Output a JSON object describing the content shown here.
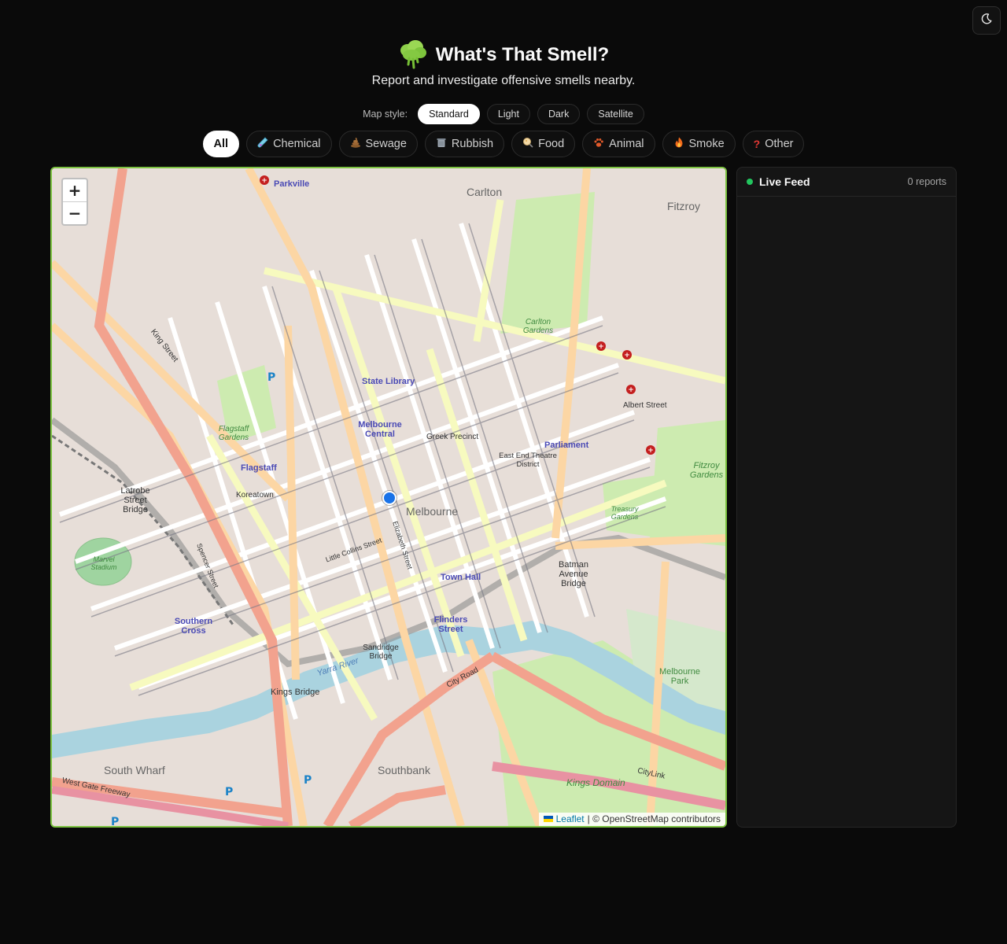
{
  "theme_toggle": {
    "icon": "moon-icon"
  },
  "header": {
    "logo_icon": "cloud-icon",
    "title": "What's That Smell?",
    "subtitle": "Report and investigate offensive smells nearby."
  },
  "map_style": {
    "label": "Map style:",
    "options": [
      "Standard",
      "Light",
      "Dark",
      "Satellite"
    ],
    "selected": "Standard"
  },
  "categories": [
    {
      "label": "All",
      "icon": "",
      "active": true
    },
    {
      "label": "Chemical",
      "icon": "test-tube-icon"
    },
    {
      "label": "Sewage",
      "icon": "poop-icon"
    },
    {
      "label": "Rubbish",
      "icon": "trash-icon"
    },
    {
      "label": "Food",
      "icon": "food-icon"
    },
    {
      "label": "Animal",
      "icon": "paw-icon"
    },
    {
      "label": "Smoke",
      "icon": "fire-icon"
    },
    {
      "label": "Other",
      "icon": "question-icon"
    }
  ],
  "map": {
    "zoom_in": "+",
    "zoom_out": "−",
    "attribution_link": "Leaflet",
    "attribution_text": "| © OpenStreetMap contributors",
    "labels": {
      "parkville": "Parkville",
      "carlton": "Carlton",
      "fitzroy": "Fitzroy",
      "carlton_gardens": "Carlton Gardens",
      "state_library": "State Library",
      "melbourne_central": "Melbourne Central",
      "flagstaff": "Flagstaff",
      "flagstaff_gardens": "Flagstaff Gardens",
      "melbourne": "Melbourne",
      "parliament": "Parliament",
      "town_hall": "Town Hall",
      "flinders_street": "Flinders Street",
      "southern_cross": "Southern Cross",
      "marvel_stadium": "Marvel Stadium",
      "southbank": "Southbank",
      "south_wharf": "South Wharf",
      "kings_domain": "Kings Domain",
      "melbourne_park": "Melbourne Park",
      "fitzroy_gardens": "Fitzroy Gardens",
      "treasury_gardens": "Treasury Gardens",
      "yarra_river": "Yarra River",
      "king_street": "King Street",
      "latrobe_bridge": "Latrobe Street Bridge",
      "batman_bridge": "Batman Avenue Bridge",
      "koreatown": "Koreatown",
      "greek_precinct": "Greek Precinct",
      "kings_bridge": "Kings Bridge",
      "sandridge_bridge": "Sandridge Bridge",
      "citylink": "CityLink",
      "west_gate": "West Gate Freeway",
      "east_end": "East End Theatre District",
      "albert_street": "Albert Street",
      "little_collins": "Little Collins Street",
      "city_road": "City Road",
      "spencer_street": "Spencer Street",
      "elizabeth_street": "Elizabeth Street"
    }
  },
  "feed": {
    "title": "Live Feed",
    "count_text": "0 reports"
  }
}
